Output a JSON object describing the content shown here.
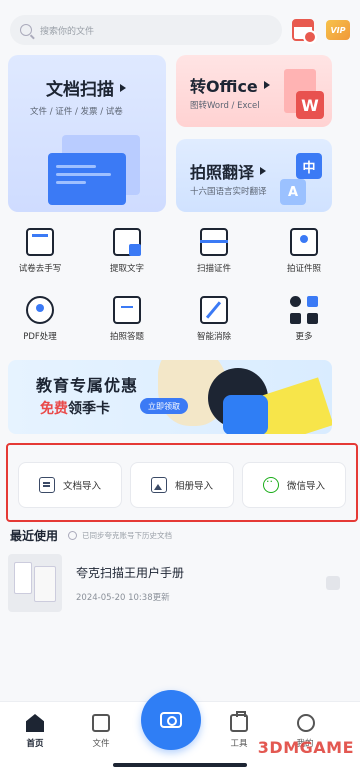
{
  "search": {
    "placeholder": "搜索你的文件"
  },
  "top_icons": {
    "vip": "VIP"
  },
  "cards": {
    "scan": {
      "title": "文档扫描",
      "subtitle": "文件 / 证件 / 发票 / 试卷"
    },
    "office": {
      "title": "转Office",
      "subtitle": "图转Word / Excel",
      "badge": "W"
    },
    "translate": {
      "title": "拍照翻译",
      "subtitle": "十六国语言实时翻译",
      "badge_zh": "中",
      "badge_en": "A"
    }
  },
  "tools": [
    {
      "label": "试卷去手写",
      "icon": "exam-icon"
    },
    {
      "label": "提取文字",
      "icon": "text-extract-icon"
    },
    {
      "label": "扫描证件",
      "icon": "id-scan-icon"
    },
    {
      "label": "拍证件照",
      "icon": "id-photo-icon"
    },
    {
      "label": "PDF处理",
      "icon": "pdf-icon"
    },
    {
      "label": "拍照答题",
      "icon": "answer-icon"
    },
    {
      "label": "智能消除",
      "icon": "magic-erase-icon"
    },
    {
      "label": "更多",
      "icon": "more-grid-icon"
    }
  ],
  "banner": {
    "title": "教育专属优惠",
    "free": "免费",
    "rest": "领季卡",
    "button": "立即领取"
  },
  "imports": [
    {
      "label": "文档导入",
      "icon": "document-icon"
    },
    {
      "label": "相册导入",
      "icon": "image-icon"
    },
    {
      "label": "微信导入",
      "icon": "wechat-icon"
    }
  ],
  "recent": {
    "title": "最近使用",
    "note": "已同步夸克账号下历史文档",
    "items": [
      {
        "name": "夸克扫描王用户手册",
        "date": "2024-05-20 10:38更新"
      }
    ]
  },
  "nav": {
    "home": "首页",
    "files": "文件",
    "tools": "工具",
    "me": "我的"
  },
  "watermark": "3DMGAME",
  "colors": {
    "accent": "#2f7ef5",
    "highlight": "#e53935",
    "text": "#1d2533"
  }
}
